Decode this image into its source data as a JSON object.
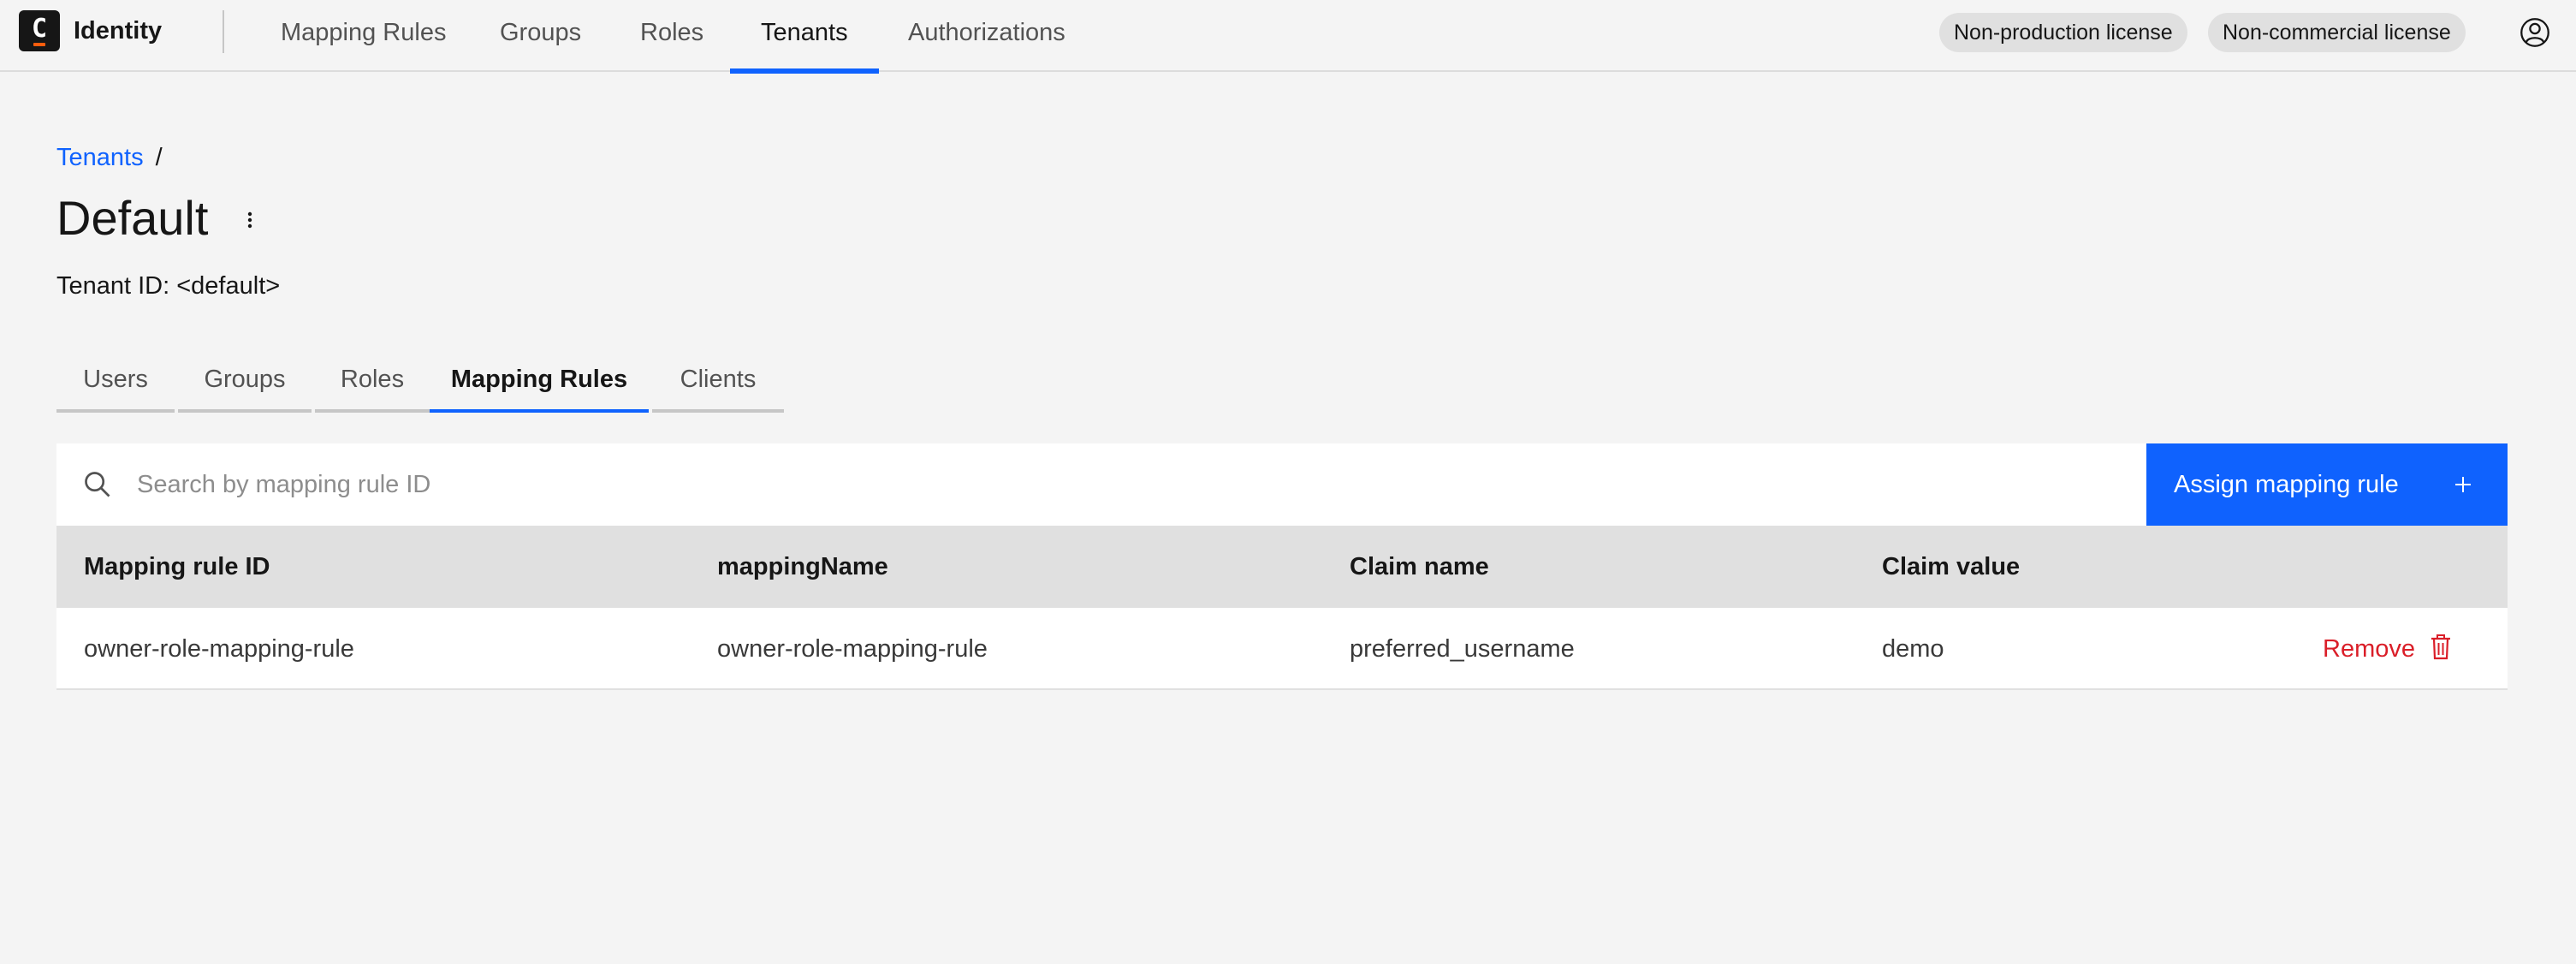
{
  "header": {
    "app_name": "Identity",
    "logo_letter": "C",
    "nav": [
      {
        "label": "Mapping Rules",
        "active": false
      },
      {
        "label": "Groups",
        "active": false
      },
      {
        "label": "Roles",
        "active": false
      },
      {
        "label": "Tenants",
        "active": true
      },
      {
        "label": "Authorizations",
        "active": false
      }
    ],
    "licenses": [
      "Non-production license",
      "Non-commercial license"
    ],
    "user_icon": "user-avatar-icon"
  },
  "breadcrumb": {
    "link": "Tenants",
    "separator": "/"
  },
  "page": {
    "title": "Default",
    "tenant_id": "Tenant ID: <default>"
  },
  "tabs": [
    {
      "label": "Users",
      "active": false
    },
    {
      "label": "Groups",
      "active": false
    },
    {
      "label": "Roles",
      "active": false
    },
    {
      "label": "Mapping Rules",
      "active": true
    },
    {
      "label": "Clients",
      "active": false
    }
  ],
  "toolbar": {
    "search_placeholder": "Search by mapping rule ID",
    "assign_label": "Assign mapping rule"
  },
  "table": {
    "columns": [
      "Mapping rule ID",
      "mappingName",
      "Claim name",
      "Claim value"
    ],
    "rows": [
      {
        "cells": [
          "owner-role-mapping-rule",
          "owner-role-mapping-rule",
          "preferred_username",
          "demo"
        ],
        "action": "Remove"
      }
    ]
  },
  "colors": {
    "accent": "#0f62fe",
    "danger": "#da1e28",
    "logo_bar": "#fc5d0d"
  }
}
